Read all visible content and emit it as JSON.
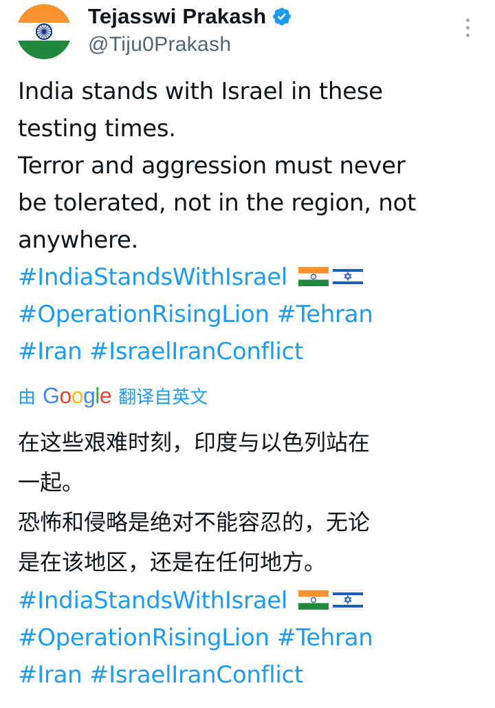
{
  "author": {
    "display_name": "Tejasswi Prakash",
    "handle": "@Tiju0Prakash",
    "verified": true,
    "avatar": "india-flag-avatar"
  },
  "tweet": {
    "lines": [
      "India stands with Israel in these",
      "testing times.",
      "Terror and aggression must never",
      "be tolerated, not in the region, not",
      "anywhere."
    ],
    "hashtags": {
      "line1": "#IndiaStandsWithIsrael",
      "line2a": "#OperationRisingLion",
      "line2b": "#Tehran",
      "line3a": "#Iran",
      "line3b": "#IsraelIranConflict"
    },
    "flags": [
      "india-flag-emoji",
      "israel-flag-emoji"
    ]
  },
  "translation": {
    "prefix": "由",
    "provider": "Google",
    "suffix": "翻译自英文",
    "lines": [
      "在这些艰难时刻，印度与以色列站在",
      "一起。",
      "恐怖和侵略是绝对不能容忍的，无论",
      "是在该地区，还是在任何地方。"
    ],
    "hashtags": {
      "line1": "#IndiaStandsWithIsrael",
      "line2a": "#OperationRisingLion",
      "line2b": "#Tehran",
      "line3a": "#Iran",
      "line3b": "#IsraelIranConflict"
    }
  },
  "colors": {
    "link": "#1d9bf0",
    "text": "#0f1419",
    "secondary": "#536471",
    "verified": "#1d9bf0"
  },
  "icons": {
    "more": "more-vertical-icon",
    "verified": "verified-badge-icon"
  }
}
